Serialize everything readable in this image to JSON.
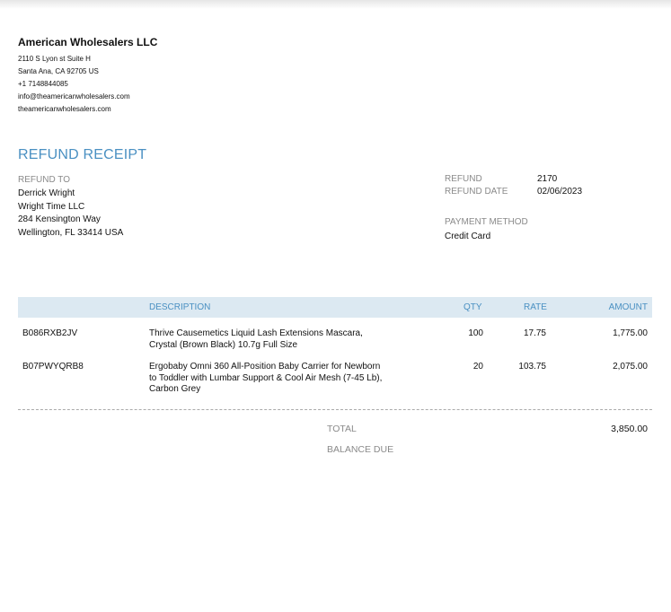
{
  "company": {
    "name": "American Wholesalers LLC",
    "address1": "2110 S Lyon st Suite H",
    "address2": "Santa Ana, CA  92705 US",
    "phone": "+1 7148844085",
    "email": "info@theamericanwholesalers.com",
    "website": "theamericanwholesalers.com"
  },
  "document_title": "REFUND RECEIPT",
  "refund_to": {
    "label": "REFUND TO",
    "name": "Derrick Wright",
    "company": "Wright Time LLC",
    "street": "284 Kensington Way",
    "city": "Wellington, FL  33414 USA"
  },
  "meta": {
    "refund_label": "REFUND",
    "refund_value": "2170",
    "date_label": "REFUND DATE",
    "date_value": "02/06/2023",
    "payment_label": "PAYMENT METHOD",
    "payment_value": "Credit Card"
  },
  "table": {
    "headers": {
      "description": "DESCRIPTION",
      "qty": "QTY",
      "rate": "RATE",
      "amount": "AMOUNT"
    },
    "rows": [
      {
        "sku": "B086RXB2JV",
        "desc": [
          "Thrive Causemetics Liquid Lash Extensions Mascara,",
          "Crystal (Brown Black) 10.7g Full Size"
        ],
        "qty": "100",
        "rate": "17.75",
        "amount": "1,775.00"
      },
      {
        "sku": "B07PWYQRB8",
        "desc": [
          "Ergobaby Omni 360 All-Position Baby Carrier for Newborn",
          "to Toddler with Lumbar Support & Cool Air Mesh (7-45 Lb),",
          "Carbon Grey"
        ],
        "qty": "20",
        "rate": "103.75",
        "amount": "2,075.00"
      }
    ]
  },
  "totals": {
    "total_label": "TOTAL",
    "total_value": "3,850.00",
    "balance_label": "BALANCE DUE"
  }
}
